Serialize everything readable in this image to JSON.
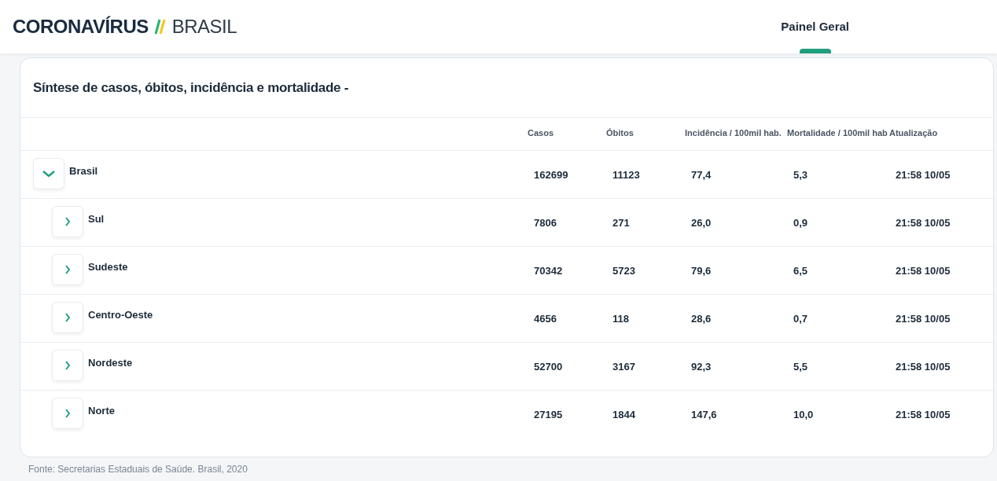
{
  "header": {
    "logo_main": "CORONAVÍRUS",
    "logo_sub": "BRASIL",
    "tabs": [
      {
        "label": "Painel Geral",
        "selected": true
      }
    ]
  },
  "panel": {
    "title": "Síntese de casos, óbitos, incidência e mortalidade -",
    "columns": [
      "Casos",
      "Óbitos",
      "Incidência / 100mil hab.",
      "Mortalidade / 100mil hab",
      "Atualização"
    ],
    "rows": [
      {
        "name": "Brasil",
        "expanded": true,
        "values": [
          "162699",
          "11123",
          "77,4",
          "5,3",
          "21:58 10/05"
        ],
        "children": [
          {
            "name": "Sul",
            "expanded": false,
            "values": [
              "7806",
              "271",
              "26,0",
              "0,9",
              "21:58 10/05"
            ]
          },
          {
            "name": "Sudeste",
            "expanded": false,
            "values": [
              "70342",
              "5723",
              "79,6",
              "6,5",
              "21:58 10/05"
            ]
          },
          {
            "name": "Centro-Oeste",
            "expanded": false,
            "values": [
              "4656",
              "118",
              "28,6",
              "0,7",
              "21:58 10/05"
            ]
          },
          {
            "name": "Nordeste",
            "expanded": false,
            "values": [
              "52700",
              "3167",
              "92,3",
              "5,5",
              "21:58 10/05"
            ]
          },
          {
            "name": "Norte",
            "expanded": false,
            "values": [
              "27195",
              "1844",
              "147,6",
              "10,0",
              "21:58 10/05"
            ]
          }
        ]
      }
    ]
  },
  "source": "Fonte: Secretarias Estaduais de Saúde. Brasil, 2020"
}
